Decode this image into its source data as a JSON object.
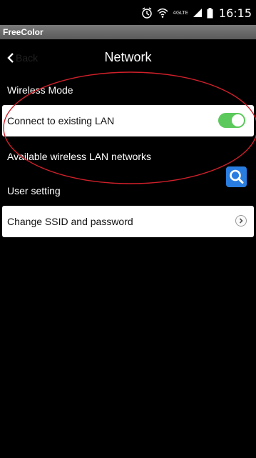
{
  "status_bar": {
    "network_type": "4GLTE",
    "time": "16:15",
    "icons": [
      "alarm-icon",
      "wifi-icon",
      "signal-icon",
      "battery-icon"
    ]
  },
  "app_titlebar": {
    "title": "FreeColor"
  },
  "nav": {
    "back_label": "Back",
    "title": "Network"
  },
  "sections": {
    "wireless_mode": "Wireless Mode",
    "user_setting": "User setting"
  },
  "rows": {
    "connect_lan": {
      "label": "Connect to existing LAN",
      "toggle_on": true
    },
    "available_networks": {
      "label": "Available wireless LAN networks"
    },
    "change_ssid": {
      "label": "Change SSID and password"
    }
  },
  "colors": {
    "background": "#000000",
    "toggle_on": "#5cc95c",
    "search_button": "#2a7de0",
    "annotation_ellipse": "#d0202a"
  }
}
